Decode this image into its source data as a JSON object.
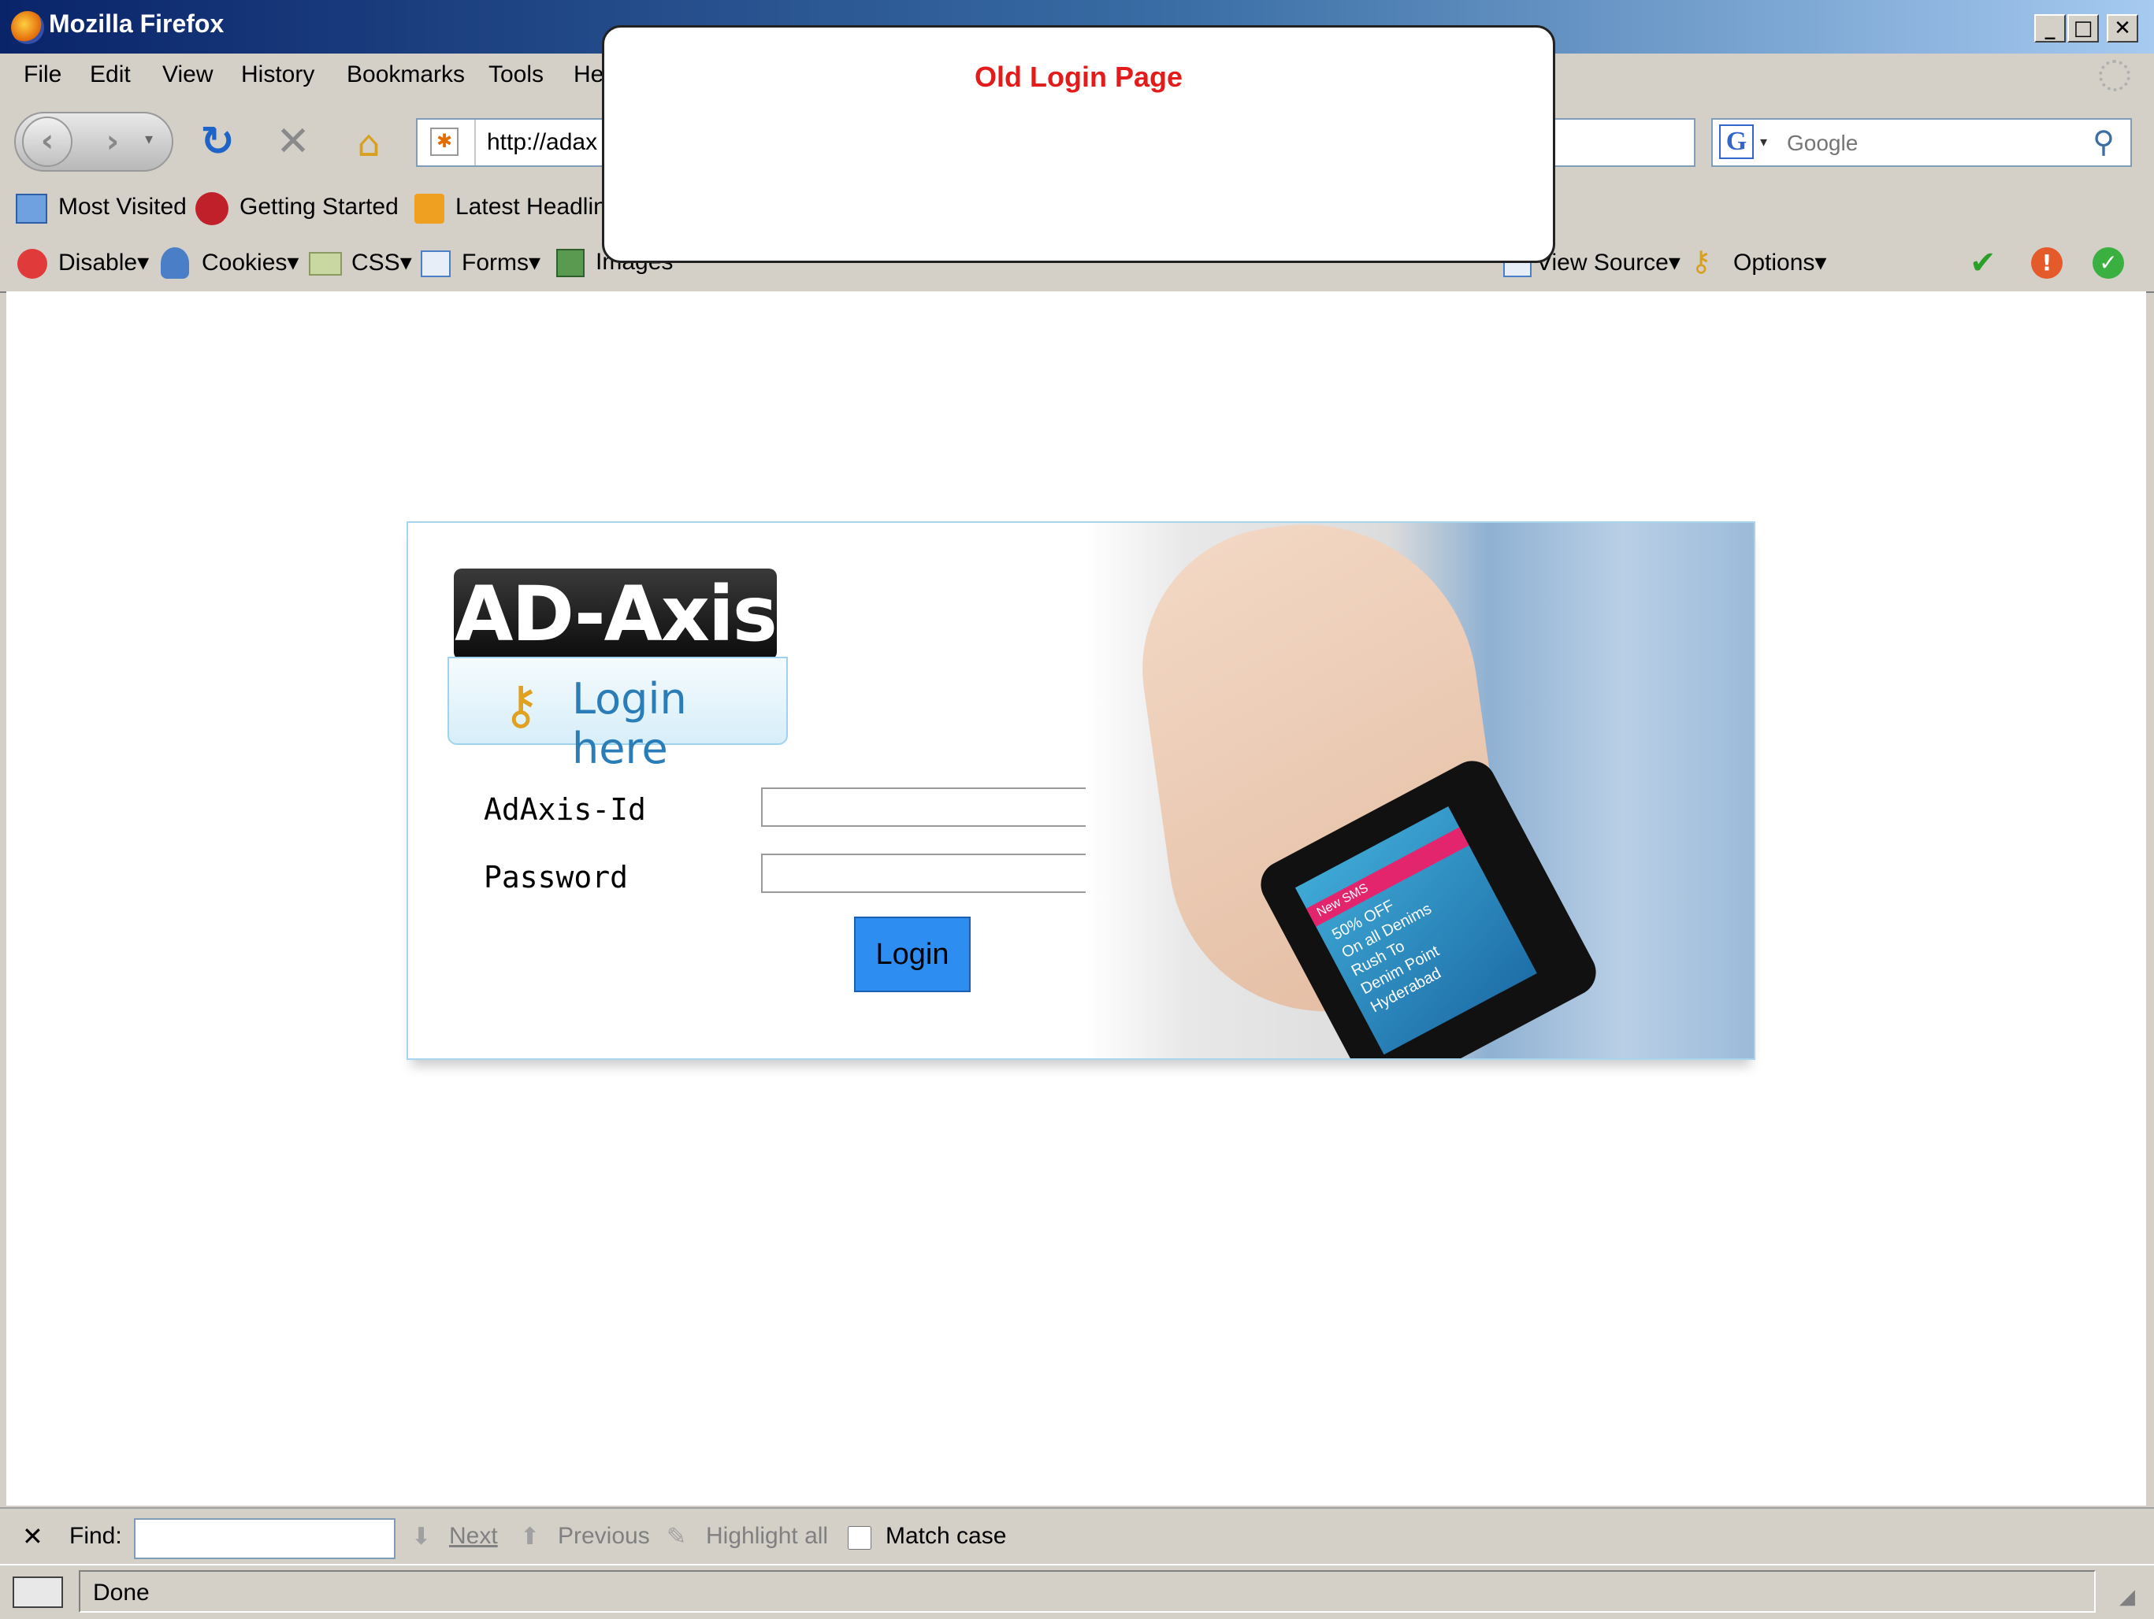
{
  "window": {
    "title": "Mozilla Firefox",
    "min": "_",
    "max": "□",
    "close": "✕"
  },
  "menu": [
    "File",
    "Edit",
    "View",
    "History",
    "Bookmarks",
    "Tools",
    "He"
  ],
  "nav": {
    "url": "http://adax",
    "search_placeholder": "Google"
  },
  "bookmarks": [
    "Most Visited",
    "Getting Started",
    "Latest Headlin"
  ],
  "devbar": {
    "left": [
      "Disable",
      "Cookies",
      "CSS",
      "Forms",
      "Images"
    ],
    "right": [
      "View Source",
      "Options"
    ]
  },
  "popup": {
    "title": "Old Login Page"
  },
  "login": {
    "brand": "AD-Axis",
    "subtitle": "Login here",
    "id_label": "AdAxis-Id",
    "password_label": "Password",
    "button": "Login",
    "promo": [
      "New SMS",
      "50% OFF",
      "On all Denims",
      "Rush To",
      "Denim Point",
      "Hyderabad"
    ]
  },
  "findbar": {
    "close": "✕",
    "label": "Find:",
    "next": "Next",
    "previous": "Previous",
    "highlight": "Highlight all",
    "match_case": "Match case"
  },
  "status": {
    "text": "Done"
  },
  "colors": {
    "accent": "#2e8df0",
    "popup_title": "#e41b1b",
    "title_bar": "#0a246a"
  }
}
